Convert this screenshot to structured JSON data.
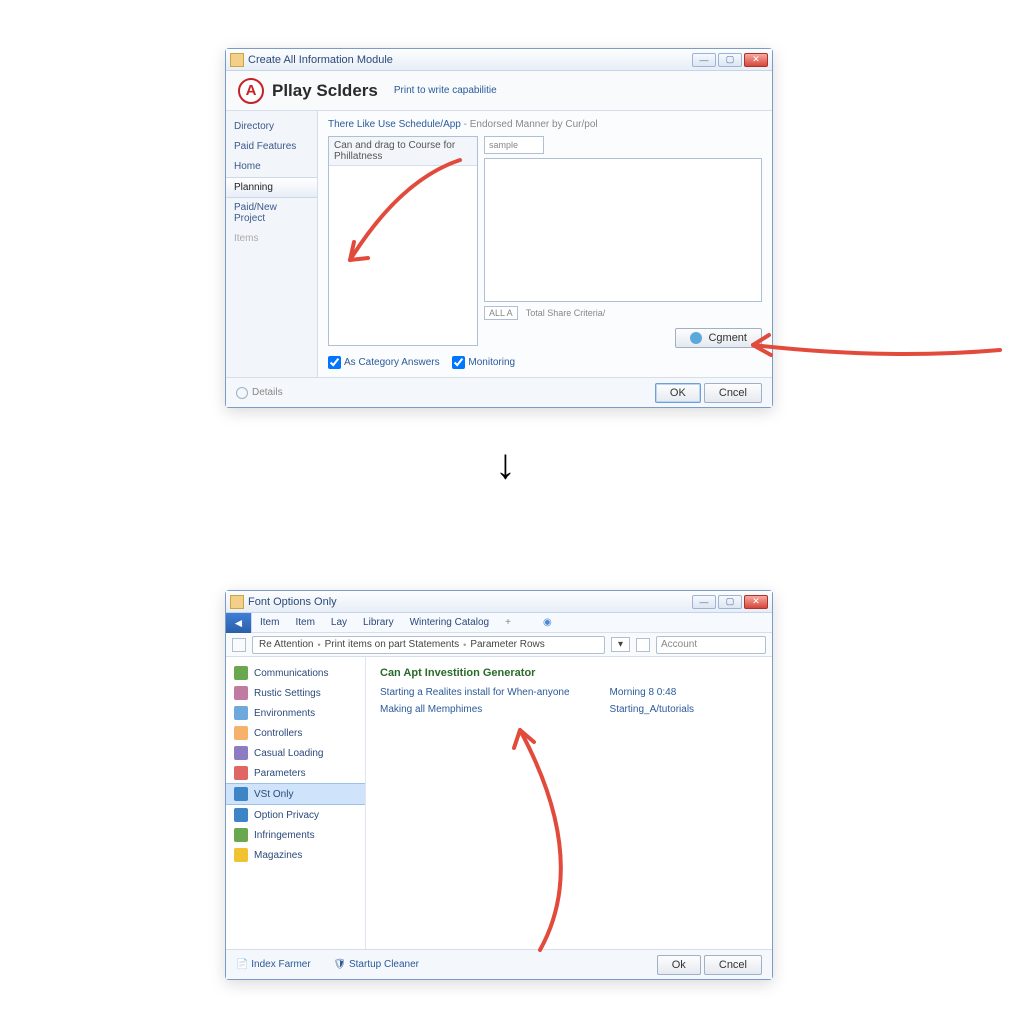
{
  "w1": {
    "titlebar": "Create All Information Module",
    "app_title": "Pllay Sclders",
    "header_link": "Print to write capabilitie",
    "sidebar": {
      "items": [
        {
          "label": "Directory"
        },
        {
          "label": "Paid Features"
        },
        {
          "label": "Home"
        },
        {
          "label": "Planning"
        },
        {
          "label": "Paid/New Project"
        },
        {
          "label": "Items"
        }
      ],
      "selected_index": 3
    },
    "section_label": "There Like Use Schedule/App",
    "section_sub": "- Endorsed Manner by Cur/pol",
    "list_header": "Can and drag to Course for Phillatness",
    "dropdown": "sample",
    "below_tag": "ALL A",
    "below_text": "Total Share Criteria/",
    "comment_btn": "Cgment",
    "checkboxes": {
      "a_label": "As Category Answers",
      "b_label": "Monitoring"
    },
    "footer_hint": "Details",
    "ok": "OK",
    "cancel": "Cncel"
  },
  "w2": {
    "titlebar": "Font Options Only",
    "menu": [
      "Item",
      "Item",
      "Lay",
      "Library",
      "Wintering Catalog"
    ],
    "breadcrumb": [
      "Re Attention",
      "Print items on part Statements",
      "Parameter Rows"
    ],
    "search_placeholder": "Account",
    "sidebar": {
      "items": [
        {
          "label": "Communications",
          "color": "#6aa84f"
        },
        {
          "label": "Rustic Settings",
          "color": "#c27ba0"
        },
        {
          "label": "Environments",
          "color": "#6fa8dc"
        },
        {
          "label": "Controllers",
          "color": "#f6b26b"
        },
        {
          "label": "Casual Loading",
          "color": "#8e7cc3"
        },
        {
          "label": "Parameters",
          "color": "#e06666"
        },
        {
          "label": "VSt Only",
          "color": "#3d85c6"
        },
        {
          "label": "Option Privacy",
          "color": "#3d85c6"
        },
        {
          "label": "Infringements",
          "color": "#6aa84f"
        },
        {
          "label": "Magazines",
          "color": "#f1c232"
        }
      ],
      "selected_index": 6
    },
    "heading": "Can Apt Investition Generator",
    "links_left": [
      "Starting a Realites install for When-anyone",
      "Making all Memphimes"
    ],
    "links_right": [
      "Morning 8 0:48",
      "Starting_A/tutorials"
    ],
    "footer_links": [
      "Index Farmer",
      "Startup Cleaner"
    ],
    "ok": "Ok",
    "cancel": "Cncel",
    "drop_marker": "▾"
  }
}
